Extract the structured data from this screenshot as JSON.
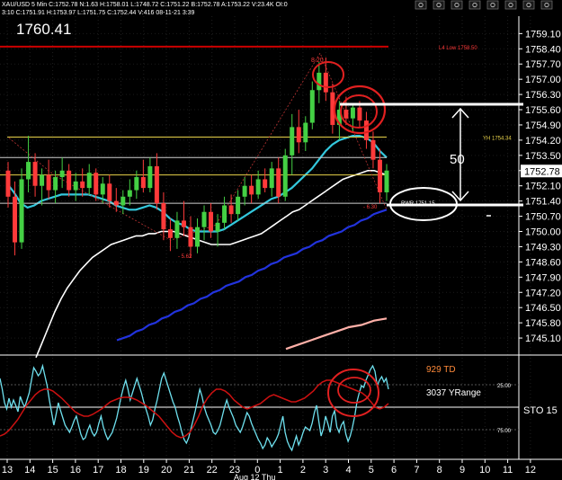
{
  "header": {
    "symbol_line": "XAU/USD 5 Min C:1752.78 N:1.63 H:1758.01 L:1748.72 C:1751.22 B:1752.78 A:1753.22 V:23.4K OI:0",
    "sub_line": "3:10 C:1751.91 H:1753.97 L:1751.75 C:1752.44 V:416 08-11-21 3:39",
    "last_price": "1760.41",
    "toolbar_icons": [
      "pointer-icon",
      "crosshair-icon",
      "drag-icon",
      "chart-icon",
      "zoom-in-icon",
      "zoom-out-icon",
      "window-icon",
      "close-icon"
    ]
  },
  "colors": {
    "background": "#000000",
    "candle_up": "#44d044",
    "candle_down": "#ff3a3a",
    "ema_fast": "#33c8dd",
    "ema_mid": "#ffffff",
    "ema_slow": "#2233dd",
    "ema_slowest": "#ffb0a8",
    "level_yh": "#e8d24a",
    "level_red": "#cc0000",
    "sto_line": "#6ee0ee",
    "sto_signal": "#cc1111",
    "annotation": "#ffffff",
    "circle": "#e02020"
  },
  "chart_data": [
    {
      "type": "candlestick",
      "title": "",
      "ylim": [
        1744.4,
        1759.9
      ],
      "yticks": [
        "1759.10",
        "1758.40",
        "1757.70",
        "1757.00",
        "1756.30",
        "1755.60",
        "1754.90",
        "1754.20",
        "1753.50",
        "1752.80",
        "1752.10",
        "1751.40",
        "1750.70",
        "1750.00",
        "1749.30",
        "1748.60",
        "1747.90",
        "1747.20",
        "1746.50",
        "1745.80",
        "1745.10"
      ],
      "last_price_label": "1752.78",
      "xticks": [
        "13",
        "14",
        "15",
        "16",
        "17",
        "18",
        "19",
        "20",
        "21",
        "22",
        "23",
        "0",
        "1",
        "2",
        "3",
        "4",
        "5",
        "6",
        "7",
        "8",
        "9",
        "10",
        "11",
        "12"
      ],
      "date_label": "Aug 12 Thu",
      "candles": [
        {
          "o": 1752.8,
          "h": 1753.2,
          "l": 1751.1,
          "c": 1751.6
        },
        {
          "o": 1751.6,
          "h": 1752.3,
          "l": 1748.9,
          "c": 1749.5
        },
        {
          "o": 1749.5,
          "h": 1752.9,
          "l": 1749.2,
          "c": 1752.4
        },
        {
          "o": 1752.4,
          "h": 1754.4,
          "l": 1751.8,
          "c": 1753.2
        },
        {
          "o": 1753.2,
          "h": 1753.6,
          "l": 1751.6,
          "c": 1752.1
        },
        {
          "o": 1752.1,
          "h": 1752.9,
          "l": 1751.2,
          "c": 1752.6
        },
        {
          "o": 1752.6,
          "h": 1753.3,
          "l": 1751.5,
          "c": 1751.9
        },
        {
          "o": 1751.9,
          "h": 1752.8,
          "l": 1751.3,
          "c": 1752.5
        },
        {
          "o": 1752.5,
          "h": 1753.4,
          "l": 1752.0,
          "c": 1752.8
        },
        {
          "o": 1752.8,
          "h": 1753.1,
          "l": 1751.6,
          "c": 1751.9
        },
        {
          "o": 1751.9,
          "h": 1752.7,
          "l": 1751.4,
          "c": 1752.3
        },
        {
          "o": 1752.3,
          "h": 1752.9,
          "l": 1751.6,
          "c": 1752.0
        },
        {
          "o": 1752.0,
          "h": 1753.1,
          "l": 1751.7,
          "c": 1752.7
        },
        {
          "o": 1752.7,
          "h": 1752.9,
          "l": 1751.4,
          "c": 1751.7
        },
        {
          "o": 1751.7,
          "h": 1752.5,
          "l": 1751.3,
          "c": 1752.2
        },
        {
          "o": 1752.2,
          "h": 1752.6,
          "l": 1751.1,
          "c": 1751.4
        },
        {
          "o": 1751.4,
          "h": 1752.0,
          "l": 1750.9,
          "c": 1751.2
        },
        {
          "o": 1751.2,
          "h": 1751.9,
          "l": 1750.8,
          "c": 1751.6
        },
        {
          "o": 1751.6,
          "h": 1752.4,
          "l": 1751.2,
          "c": 1751.9
        },
        {
          "o": 1751.9,
          "h": 1752.8,
          "l": 1751.5,
          "c": 1752.5
        },
        {
          "o": 1752.5,
          "h": 1753.3,
          "l": 1751.8,
          "c": 1752.0
        },
        {
          "o": 1752.0,
          "h": 1753.4,
          "l": 1751.8,
          "c": 1753.0
        },
        {
          "o": 1753.0,
          "h": 1753.6,
          "l": 1751.0,
          "c": 1751.3
        },
        {
          "o": 1751.3,
          "h": 1751.8,
          "l": 1749.6,
          "c": 1750.1
        },
        {
          "o": 1750.1,
          "h": 1750.6,
          "l": 1749.1,
          "c": 1749.7
        },
        {
          "o": 1749.7,
          "h": 1750.9,
          "l": 1749.2,
          "c": 1750.5
        },
        {
          "o": 1750.5,
          "h": 1751.4,
          "l": 1749.8,
          "c": 1750.2
        },
        {
          "o": 1750.2,
          "h": 1750.7,
          "l": 1748.8,
          "c": 1749.3
        },
        {
          "o": 1749.3,
          "h": 1750.6,
          "l": 1749.0,
          "c": 1750.2
        },
        {
          "o": 1750.2,
          "h": 1751.2,
          "l": 1749.6,
          "c": 1750.9
        },
        {
          "o": 1750.9,
          "h": 1751.3,
          "l": 1749.7,
          "c": 1750.0
        },
        {
          "o": 1750.0,
          "h": 1750.8,
          "l": 1749.3,
          "c": 1750.4
        },
        {
          "o": 1750.4,
          "h": 1751.6,
          "l": 1750.1,
          "c": 1751.2
        },
        {
          "o": 1751.2,
          "h": 1751.7,
          "l": 1750.4,
          "c": 1750.8
        },
        {
          "o": 1750.8,
          "h": 1751.9,
          "l": 1750.5,
          "c": 1751.6
        },
        {
          "o": 1751.6,
          "h": 1752.5,
          "l": 1751.2,
          "c": 1752.1
        },
        {
          "o": 1752.1,
          "h": 1752.6,
          "l": 1751.3,
          "c": 1751.7
        },
        {
          "o": 1751.7,
          "h": 1752.8,
          "l": 1751.5,
          "c": 1752.4
        },
        {
          "o": 1752.4,
          "h": 1752.9,
          "l": 1751.8,
          "c": 1752.0
        },
        {
          "o": 1752.0,
          "h": 1753.2,
          "l": 1751.6,
          "c": 1752.9
        },
        {
          "o": 1752.9,
          "h": 1753.4,
          "l": 1751.3,
          "c": 1751.6
        },
        {
          "o": 1751.6,
          "h": 1753.8,
          "l": 1751.4,
          "c": 1753.5
        },
        {
          "o": 1753.5,
          "h": 1755.4,
          "l": 1752.6,
          "c": 1754.8
        },
        {
          "o": 1754.8,
          "h": 1755.6,
          "l": 1753.6,
          "c": 1754.1
        },
        {
          "o": 1754.1,
          "h": 1755.3,
          "l": 1753.7,
          "c": 1755.0
        },
        {
          "o": 1755.0,
          "h": 1756.9,
          "l": 1754.7,
          "c": 1756.5
        },
        {
          "o": 1756.5,
          "h": 1757.8,
          "l": 1755.9,
          "c": 1757.3
        },
        {
          "o": 1757.3,
          "h": 1758.0,
          "l": 1756.0,
          "c": 1756.4
        },
        {
          "o": 1756.4,
          "h": 1756.8,
          "l": 1754.5,
          "c": 1754.9
        },
        {
          "o": 1754.9,
          "h": 1756.0,
          "l": 1754.2,
          "c": 1755.6
        },
        {
          "o": 1755.6,
          "h": 1756.2,
          "l": 1754.9,
          "c": 1755.2
        },
        {
          "o": 1755.2,
          "h": 1755.9,
          "l": 1754.6,
          "c": 1755.7
        },
        {
          "o": 1755.7,
          "h": 1756.0,
          "l": 1754.8,
          "c": 1755.1
        },
        {
          "o": 1755.1,
          "h": 1755.5,
          "l": 1753.8,
          "c": 1754.2
        },
        {
          "o": 1754.2,
          "h": 1754.6,
          "l": 1752.9,
          "c": 1753.3
        },
        {
          "o": 1753.3,
          "h": 1753.8,
          "l": 1751.3,
          "c": 1751.8
        },
        {
          "o": 1751.8,
          "h": 1753.1,
          "l": 1751.4,
          "c": 1752.8
        }
      ],
      "overlays": [
        {
          "name": "ema_fast",
          "values": [
            1752.2,
            1751.8,
            1751.3,
            1751.1,
            1751.2,
            1751.4,
            1751.5,
            1751.6,
            1751.7,
            1751.7,
            1751.7,
            1751.7,
            1751.7,
            1751.6,
            1751.5,
            1751.4,
            1751.2,
            1751.1,
            1751.0,
            1751.0,
            1751.1,
            1751.2,
            1751.1,
            1750.9,
            1750.6,
            1750.4,
            1750.3,
            1750.1,
            1750.0,
            1750.0,
            1750.0,
            1750.0,
            1750.1,
            1750.3,
            1750.5,
            1750.7,
            1750.9,
            1751.1,
            1751.3,
            1751.5,
            1751.6,
            1751.8,
            1752.0,
            1752.3,
            1752.6,
            1752.9,
            1753.3,
            1753.7,
            1754.0,
            1754.2,
            1754.3,
            1754.4,
            1754.4,
            1754.3,
            1754.1,
            1753.7,
            1753.4
          ]
        },
        {
          "name": "ema_mid",
          "values": [
            1744.2,
            1744.9,
            1745.6,
            1746.3,
            1746.9,
            1747.4,
            1747.8,
            1748.2,
            1748.5,
            1748.8,
            1749.0,
            1749.2,
            1749.4,
            1749.5,
            1749.6,
            1749.7,
            1749.8,
            1749.8,
            1749.9,
            1749.9,
            1750.0,
            1750.0,
            1750.0,
            1749.9,
            1749.8,
            1749.7,
            1749.6,
            1749.5,
            1749.4,
            1749.4,
            1749.4,
            1749.4,
            1749.5,
            1749.6,
            1749.7,
            1749.8,
            1749.9,
            1750.1,
            1750.3,
            1750.5,
            1750.7,
            1750.9,
            1751.0,
            1751.2,
            1751.4,
            1751.6,
            1751.8,
            1752.0,
            1752.2,
            1752.4,
            1752.5,
            1752.6,
            1752.7,
            1752.8,
            1752.8,
            1752.7,
            1752.6
          ]
        },
        {
          "name": "ema_slow",
          "values": [
            1745.0,
            1745.1,
            1745.2,
            1745.4,
            1745.5,
            1745.7,
            1745.8,
            1746.0,
            1746.1,
            1746.3,
            1746.4,
            1746.6,
            1746.7,
            1746.9,
            1747.0,
            1747.2,
            1747.3,
            1747.5,
            1747.6,
            1747.7,
            1747.9,
            1748.0,
            1748.2,
            1748.3,
            1748.5,
            1748.6,
            1748.8,
            1748.9,
            1749.0,
            1749.2,
            1749.3,
            1749.5,
            1749.6,
            1749.8,
            1749.9,
            1750.0,
            1750.2,
            1750.3,
            1750.5,
            1750.6,
            1750.8,
            1750.9,
            1751.0
          ]
        },
        {
          "name": "ema_slowest",
          "values": [
            1744.6,
            1744.8,
            1745.0,
            1745.2,
            1745.4,
            1745.6,
            1745.7,
            1745.9,
            1746.0
          ]
        }
      ],
      "levels": [
        {
          "name": "red_level",
          "y": 1758.5,
          "label": "L4 Low 1758.50"
        },
        {
          "name": "yh_level",
          "y": 1754.34,
          "label": "YH 1754.34"
        },
        {
          "name": "range_line_1",
          "y": 1753.4,
          "label": ""
        },
        {
          "name": "range_line_2",
          "y": 1752.6,
          "label": ""
        },
        {
          "name": "range_line_3",
          "y": 1751.3,
          "label": ""
        }
      ],
      "annotations": [
        {
          "text": "8.20",
          "color": "#ff3a3a"
        },
        {
          "text": "- 5.62",
          "color": "#ff3a3a"
        },
        {
          "text": "- 6.30",
          "color": "#ff3a3a"
        },
        {
          "text": "RWR 1751.15",
          "color": "#ffffff"
        },
        {
          "text": "50",
          "color": "#ffffff"
        }
      ]
    },
    {
      "type": "line",
      "title": "STO",
      "name_label": "STO 15",
      "ylim": [
        0,
        100
      ],
      "yticks": [
        "25.00",
        "75.00"
      ],
      "legend": [
        "929 TD",
        "3037 YRange"
      ],
      "series": [
        {
          "name": "sto",
          "values": [
            82,
            70,
            55,
            48,
            60,
            50,
            58,
            52,
            45,
            62,
            55,
            50,
            58,
            66,
            80,
            94,
            90,
            85,
            88,
            96,
            85,
            74,
            58,
            44,
            30,
            42,
            55,
            46,
            38,
            30,
            26,
            22,
            28,
            35,
            40,
            30,
            20,
            14,
            16,
            24,
            30,
            22,
            18,
            22,
            32,
            40,
            28,
            20,
            14,
            18,
            22,
            30,
            38,
            50,
            62,
            72,
            80,
            70,
            58,
            66,
            74,
            82,
            74,
            66,
            56,
            48,
            40,
            30,
            36,
            48,
            58,
            70,
            82,
            88,
            80,
            72,
            64,
            56,
            50,
            40,
            32,
            22,
            14,
            10,
            16,
            26,
            36,
            46,
            58,
            70,
            62,
            50,
            42,
            36,
            30,
            22,
            20,
            24,
            30,
            40,
            50,
            58,
            50,
            44,
            38,
            30,
            26,
            22,
            28,
            36,
            44,
            40,
            32,
            26,
            20,
            14,
            10,
            4,
            8,
            16,
            12,
            6,
            10,
            14,
            20,
            30,
            40,
            22,
            12,
            6,
            2,
            10,
            18,
            8,
            14,
            22,
            28,
            26,
            24,
            32,
            44,
            52,
            34,
            18,
            26,
            40,
            32,
            22,
            40,
            46,
            28,
            22,
            30,
            34,
            20,
            12,
            18,
            28,
            40,
            56,
            66,
            74,
            72,
            80,
            86,
            92,
            96,
            90,
            74,
            80,
            84,
            78,
            82,
            70
          ]
        },
        {
          "name": "sto_signal",
          "values": [
            18,
            20,
            24,
            30,
            36,
            44,
            52,
            58,
            64,
            68,
            70,
            70,
            68,
            64,
            60,
            55,
            50,
            45,
            42,
            40,
            40,
            42,
            45,
            48,
            52,
            56,
            58,
            60,
            61,
            61,
            60,
            58,
            55,
            52,
            48,
            44,
            40,
            34,
            28,
            22,
            18,
            16,
            18,
            22,
            30,
            40,
            52,
            60,
            66,
            70,
            70,
            68,
            64,
            58,
            54,
            50,
            48,
            50,
            52,
            54,
            58,
            62,
            64,
            62,
            60,
            58,
            56,
            56,
            58,
            60,
            64,
            68,
            74,
            78,
            80,
            80,
            78,
            76,
            74,
            72,
            70,
            68,
            66,
            62,
            56,
            50,
            48,
            50,
            54
          ]
        }
      ]
    }
  ]
}
